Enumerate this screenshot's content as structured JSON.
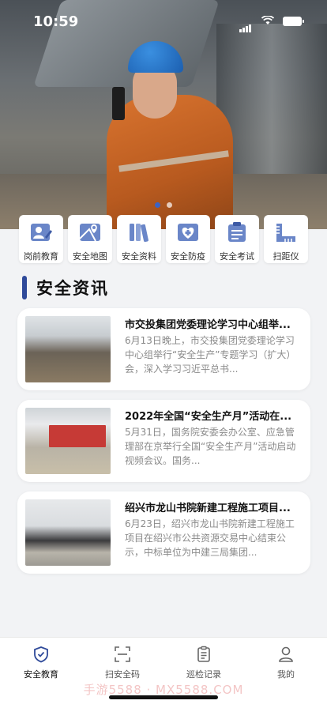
{
  "status_bar": {
    "time": "10:59"
  },
  "banner": {
    "slides": 2,
    "active_slide": 1
  },
  "quick_links": [
    {
      "label": "岗前教育",
      "icon": "pre-job-education-icon"
    },
    {
      "label": "安全地图",
      "icon": "safety-map-icon"
    },
    {
      "label": "安全资料",
      "icon": "safety-documents-icon"
    },
    {
      "label": "安全防疫",
      "icon": "epidemic-prevention-icon"
    },
    {
      "label": "安全考试",
      "icon": "safety-exam-icon"
    },
    {
      "label": "扫距仪",
      "icon": "ruler-scanner-icon"
    }
  ],
  "section": {
    "title": "安全资讯"
  },
  "news": [
    {
      "title": "市交投集团党委理论学习中心组举...",
      "summary": "6月13日晚上，市交投集团党委理论学习中心组举行“安全生产”专题学习（扩大）会，深入学习习近平总书..."
    },
    {
      "title": "2022年全国“安全生产月”活动在...",
      "summary": "5月31日，国务院安委会办公室、应急管理部在京举行全国“安全生产月”活动启动视频会议。国务..."
    },
    {
      "title": "绍兴市龙山书院新建工程施工项目...",
      "summary": "6月23日，绍兴市龙山书院新建工程施工项目在绍兴市公共资源交易中心结束公示，中标单位为中建三局集团..."
    }
  ],
  "tabs": [
    {
      "label": "安全教育",
      "icon": "shield-check-icon",
      "active": true
    },
    {
      "label": "扫安全码",
      "icon": "scan-icon",
      "active": false
    },
    {
      "label": "巡检记录",
      "icon": "clipboard-icon",
      "active": false
    },
    {
      "label": "我的",
      "icon": "user-icon",
      "active": false
    }
  ],
  "watermark": "手游5588 · MX5588.COM",
  "colors": {
    "accent": "#2f4a9a",
    "icon_blue": "#6a86c8",
    "card_bg": "#ffffff",
    "page_bg": "#f2f3f5"
  }
}
